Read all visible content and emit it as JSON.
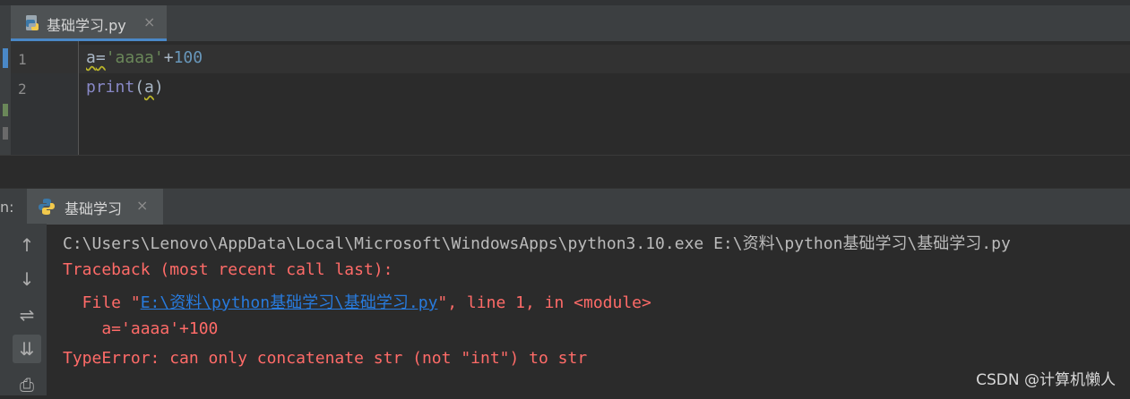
{
  "editor": {
    "tab_label": "基础学习.py",
    "tab_close": "×",
    "line_numbers": [
      "1",
      "2"
    ],
    "lines": [
      {
        "var": "a",
        "op": "=",
        "str": "'aaaa'",
        "plus": "+",
        "num": "100"
      },
      {
        "func": "print",
        "open": "(",
        "arg": "a",
        "close": ")"
      }
    ]
  },
  "run_panel": {
    "label": "n:",
    "tab_label": "基础学习",
    "tab_close": "×",
    "tools": [
      "↑",
      "↓",
      "⇌",
      "⇊",
      "⎙"
    ]
  },
  "console": {
    "command": "C:\\Users\\Lenovo\\AppData\\Local\\Microsoft\\WindowsApps\\python3.10.exe E:\\资料\\python基础学习\\基础学习.py",
    "traceback_header": "Traceback (most recent call last):",
    "file_prefix": "  File \"",
    "file_link": "E:\\资料\\python基础学习\\基础学习.py",
    "file_suffix": "\", line 1, in <module>",
    "source_line": "    a='aaaa'+100",
    "error": "TypeError: can only concatenate str (not \"int\") to str"
  },
  "watermark": "CSDN @计算机懒人",
  "colors": {
    "background": "#2b2b2b",
    "tab_active": "#4e5254",
    "accent": "#4a88c7",
    "error_text": "#ff6b68",
    "link": "#287bde"
  }
}
